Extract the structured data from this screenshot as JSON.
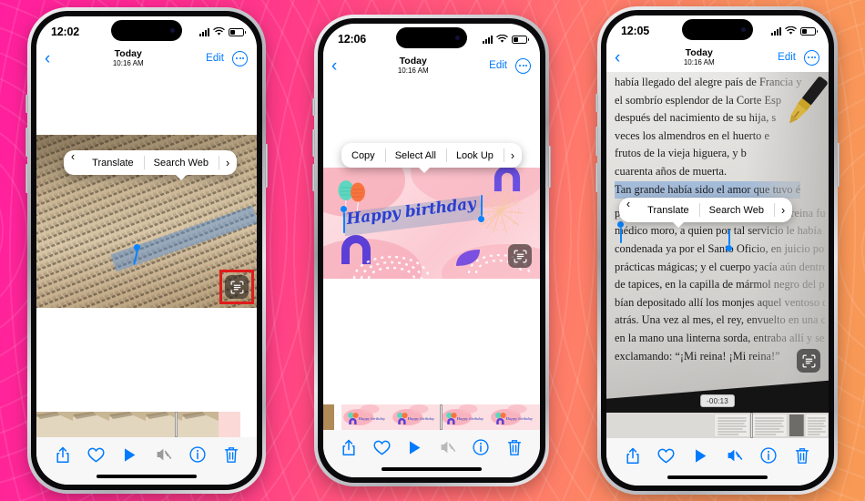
{
  "background": {
    "accent_left": "#ff1f9e",
    "accent_right": "#f89a55"
  },
  "theme": {
    "ios_blue": "#007aff",
    "selection_blue": "#0a84ff",
    "highlight_red": "#e01b1b",
    "muted_gray": "#9a9a9a"
  },
  "phones": [
    {
      "id": "phone-1",
      "status": {
        "time": "12:02",
        "signal_icon": "cellular-bars-icon",
        "wifi_icon": "wifi-icon",
        "battery_icon": "battery-icon"
      },
      "navbar": {
        "back_icon": "chevron-left-icon",
        "title": "Today",
        "subtitle": "10:16 AM",
        "edit_label": "Edit",
        "more_icon": "ellipsis-circle-icon"
      },
      "popover": {
        "left_icon": "chevron-left-icon",
        "items": [
          "Translate",
          "Search Web"
        ],
        "right_icon": "chevron-right-icon"
      },
      "media": {
        "kind": "photo-book-page",
        "live_text_icon": "live-text-scan-icon",
        "live_text_highlighted": "true"
      },
      "toolbar": {
        "items": [
          {
            "name": "share-button",
            "icon": "share-icon",
            "state": "active"
          },
          {
            "name": "favorite-button",
            "icon": "heart-icon",
            "state": "active"
          },
          {
            "name": "play-button",
            "icon": "play-icon",
            "state": "active"
          },
          {
            "name": "mute-button",
            "icon": "speaker-mute-icon",
            "state": "disabled"
          },
          {
            "name": "info-button",
            "icon": "info-circle-icon",
            "state": "active"
          },
          {
            "name": "delete-button",
            "icon": "trash-icon",
            "state": "active"
          }
        ]
      }
    },
    {
      "id": "phone-2",
      "status": {
        "time": "12:06",
        "signal_icon": "cellular-bars-icon",
        "wifi_icon": "wifi-icon",
        "battery_icon": "battery-icon"
      },
      "navbar": {
        "back_icon": "chevron-left-icon",
        "title": "Today",
        "subtitle": "10:16 AM",
        "edit_label": "Edit",
        "more_icon": "ellipsis-circle-icon"
      },
      "popover": {
        "items": [
          "Copy",
          "Select All",
          "Look Up"
        ],
        "right_icon": "chevron-right-icon"
      },
      "media": {
        "kind": "birthday-card",
        "card_text": "Happy birthday",
        "live_text_icon": "live-text-scan-icon",
        "live_text_highlighted": "false"
      },
      "toolbar": {
        "items": [
          {
            "name": "share-button",
            "icon": "share-icon",
            "state": "active"
          },
          {
            "name": "favorite-button",
            "icon": "heart-icon",
            "state": "active"
          },
          {
            "name": "play-button",
            "icon": "play-icon",
            "state": "active"
          },
          {
            "name": "mute-button",
            "icon": "speaker-mute-icon",
            "state": "disabled"
          },
          {
            "name": "info-button",
            "icon": "info-circle-icon",
            "state": "active"
          },
          {
            "name": "delete-button",
            "icon": "trash-icon",
            "state": "active"
          }
        ]
      }
    },
    {
      "id": "phone-3",
      "status": {
        "time": "12:05",
        "signal_icon": "cellular-bars-icon",
        "wifi_icon": "wifi-icon",
        "battery_icon": "battery-icon"
      },
      "navbar": {
        "back_icon": "chevron-left-icon",
        "title": "Today",
        "subtitle": "10:16 AM",
        "edit_label": "Edit",
        "more_icon": "ellipsis-circle-icon"
      },
      "popover": {
        "left_icon": "chevron-left-icon",
        "items": [
          "Translate",
          "Search Web"
        ],
        "right_icon": "chevron-right-icon"
      },
      "media": {
        "kind": "photo-book-page-zoom",
        "timestamp_badge": "-00:13",
        "live_text_icon": "live-text-scan-icon",
        "live_text_highlighted": "false",
        "book_lines": [
          "había llegado del alegre país de Francia y",
          "el sombrío esplendor de la Corte Esp",
          "después del nacimiento de su hija, s",
          "veces los almendros en el huerto e",
          "frutos de la vieja higuera, y b",
          "cuarenta años de muerta.",
          "Tan grande había sido el amor que tuvo é",
          "permitió que la tumba los separara. La reina fue",
          "médico moro, a quien por tal servicio le había otor",
          "condenada ya por el Santo Oficio, en juicio por los",
          "prácticas mágicas; y el cuerpo yacía aún dentro",
          "de tapices, en la capilla de mármol negro del pala",
          "bían depositado allí los monjes aquel ventoso día",
          "atrás. Una vez al mes, el rey, envuelto en una c",
          "en la mano una linterna sorda, entraba allí y se a",
          "exclamando: “¡Mi reina! ¡Mi reina!”"
        ],
        "selected_line_index": 6,
        "selected_text": "Tan grande había sido el"
      },
      "toolbar": {
        "items": [
          {
            "name": "share-button",
            "icon": "share-icon",
            "state": "active"
          },
          {
            "name": "favorite-button",
            "icon": "heart-icon",
            "state": "active"
          },
          {
            "name": "play-button",
            "icon": "play-icon",
            "state": "active"
          },
          {
            "name": "mute-button",
            "icon": "speaker-mute-icon",
            "state": "active"
          },
          {
            "name": "info-button",
            "icon": "info-circle-icon",
            "state": "active"
          },
          {
            "name": "delete-button",
            "icon": "trash-icon",
            "state": "active"
          }
        ]
      }
    }
  ]
}
